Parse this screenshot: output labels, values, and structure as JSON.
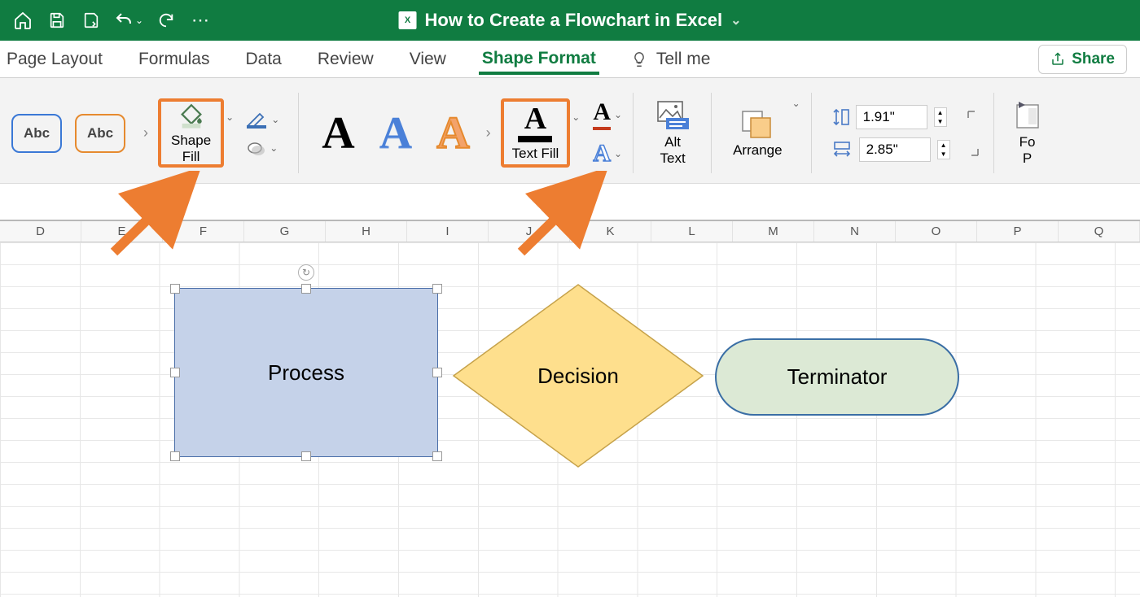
{
  "title": "How to Create a Flowchart in Excel",
  "tabs": {
    "page_layout": "Page Layout",
    "formulas": "Formulas",
    "data": "Data",
    "review": "Review",
    "view": "View",
    "shape_format": "Shape Format",
    "tell_me": "Tell me"
  },
  "share_label": "Share",
  "ribbon": {
    "style_abc": "Abc",
    "shape_fill": "Shape\nFill",
    "text_fill": "Text Fill",
    "alt_text": "Alt\nText",
    "arrange": "Arrange",
    "height": "1.91\"",
    "width": "2.85\"",
    "format_pane": "Fo\nP"
  },
  "columns": [
    "D",
    "E",
    "F",
    "G",
    "H",
    "I",
    "J",
    "K",
    "L",
    "M",
    "N",
    "O",
    "P",
    "Q"
  ],
  "shapes": {
    "process": "Process",
    "decision": "Decision",
    "terminator": "Terminator"
  }
}
